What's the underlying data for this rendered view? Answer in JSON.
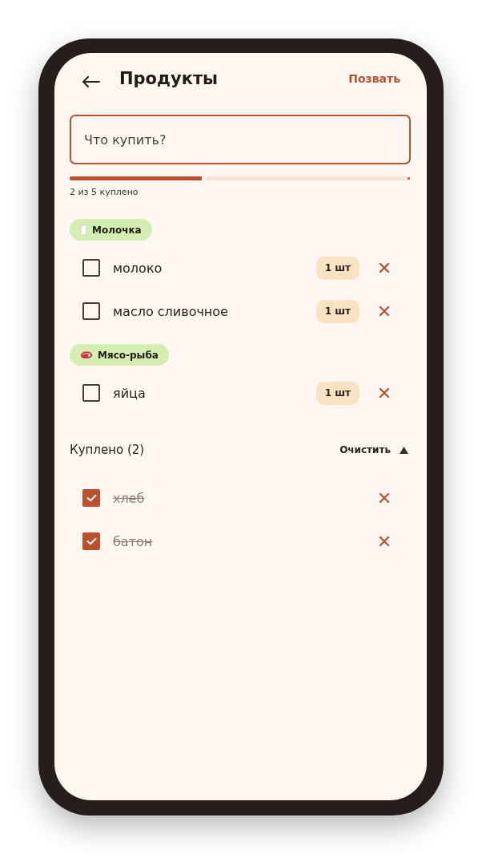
{
  "header": {
    "title": "Продукты",
    "action": "Позвать"
  },
  "search": {
    "placeholder": "Что купить?"
  },
  "progress": {
    "level": 0.4,
    "caption": "2 из 5 куплено"
  },
  "groups": [
    {
      "kind": "dairy",
      "label": "Молочка",
      "items": [
        {
          "name": "молоко",
          "quantity": "1 шт",
          "checked": false
        },
        {
          "name": "масло сливочное",
          "quantity": "1 шт",
          "checked": false
        }
      ]
    },
    {
      "kind": "meat",
      "label": "Мясо-рыба",
      "items": [
        {
          "name": "яйца",
          "quantity": "1 шт",
          "checked": false
        }
      ]
    }
  ],
  "bought": {
    "title": "Куплено (2)",
    "action": "Очистить",
    "expanded": true,
    "items": [
      {
        "name": "хлеб",
        "checked": true
      },
      {
        "name": "батон",
        "checked": true
      }
    ]
  }
}
